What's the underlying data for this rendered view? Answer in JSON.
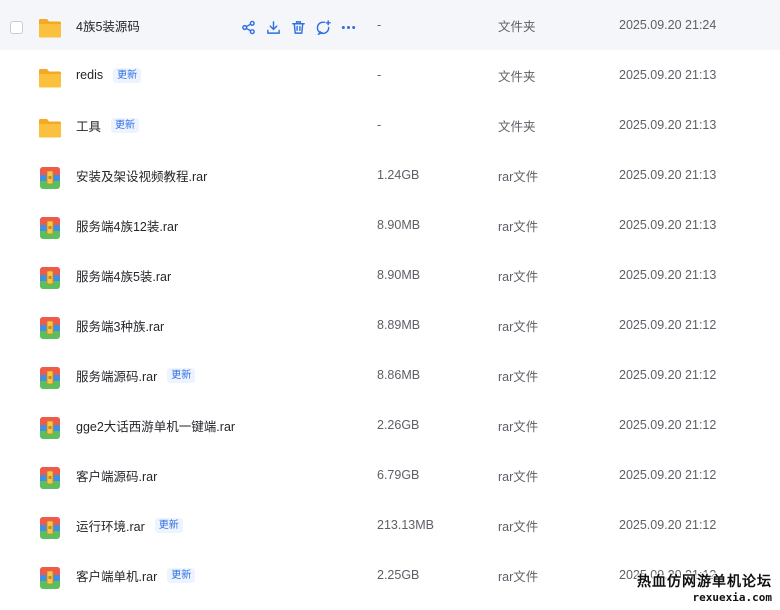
{
  "colors": {
    "accent": "#2f6fe0",
    "folder": "#f7b733",
    "row_hover": "#f5f6fa",
    "text_secondary": "#5c5f66"
  },
  "actions_icons": [
    "share-icon",
    "download-icon",
    "delete-icon",
    "comment-icon",
    "more-icon"
  ],
  "files": [
    {
      "name": "4族5装源码",
      "badge": "",
      "size": "-",
      "type": "文件夹",
      "date": "2025.09.20 21:24",
      "icon": "folder-icon",
      "hovered": true
    },
    {
      "name": "redis",
      "badge": "更新",
      "size": "-",
      "type": "文件夹",
      "date": "2025.09.20 21:13",
      "icon": "folder-icon"
    },
    {
      "name": "工具",
      "badge": "更新",
      "size": "-",
      "type": "文件夹",
      "date": "2025.09.20 21:13",
      "icon": "folder-icon"
    },
    {
      "name": "安装及架设视频教程.rar",
      "badge": "",
      "size": "1.24GB",
      "type": "rar文件",
      "date": "2025.09.20 21:13",
      "icon": "rar-archive-icon"
    },
    {
      "name": "服务端4族12装.rar",
      "badge": "",
      "size": "8.90MB",
      "type": "rar文件",
      "date": "2025.09.20 21:13",
      "icon": "rar-archive-icon"
    },
    {
      "name": "服务端4族5装.rar",
      "badge": "",
      "size": "8.90MB",
      "type": "rar文件",
      "date": "2025.09.20 21:13",
      "icon": "rar-archive-icon"
    },
    {
      "name": "服务端3种族.rar",
      "badge": "",
      "size": "8.89MB",
      "type": "rar文件",
      "date": "2025.09.20 21:12",
      "icon": "rar-archive-icon"
    },
    {
      "name": "服务端源码.rar",
      "badge": "更新",
      "size": "8.86MB",
      "type": "rar文件",
      "date": "2025.09.20 21:12",
      "icon": "rar-archive-icon"
    },
    {
      "name": "gge2大话西游单机一键端.rar",
      "badge": "",
      "size": "2.26GB",
      "type": "rar文件",
      "date": "2025.09.20 21:12",
      "icon": "rar-archive-icon"
    },
    {
      "name": "客户端源码.rar",
      "badge": "",
      "size": "6.79GB",
      "type": "rar文件",
      "date": "2025.09.20 21:12",
      "icon": "rar-archive-icon"
    },
    {
      "name": "运行环境.rar",
      "badge": "更新",
      "size": "213.13MB",
      "type": "rar文件",
      "date": "2025.09.20 21:12",
      "icon": "rar-archive-icon"
    },
    {
      "name": "客户端单机.rar",
      "badge": "更新",
      "size": "2.25GB",
      "type": "rar文件",
      "date": "2025.09.20 21:12",
      "icon": "rar-archive-icon"
    }
  ],
  "watermark": {
    "line1": "热血仿网游单机论坛",
    "line2": "rexuexia.com"
  }
}
